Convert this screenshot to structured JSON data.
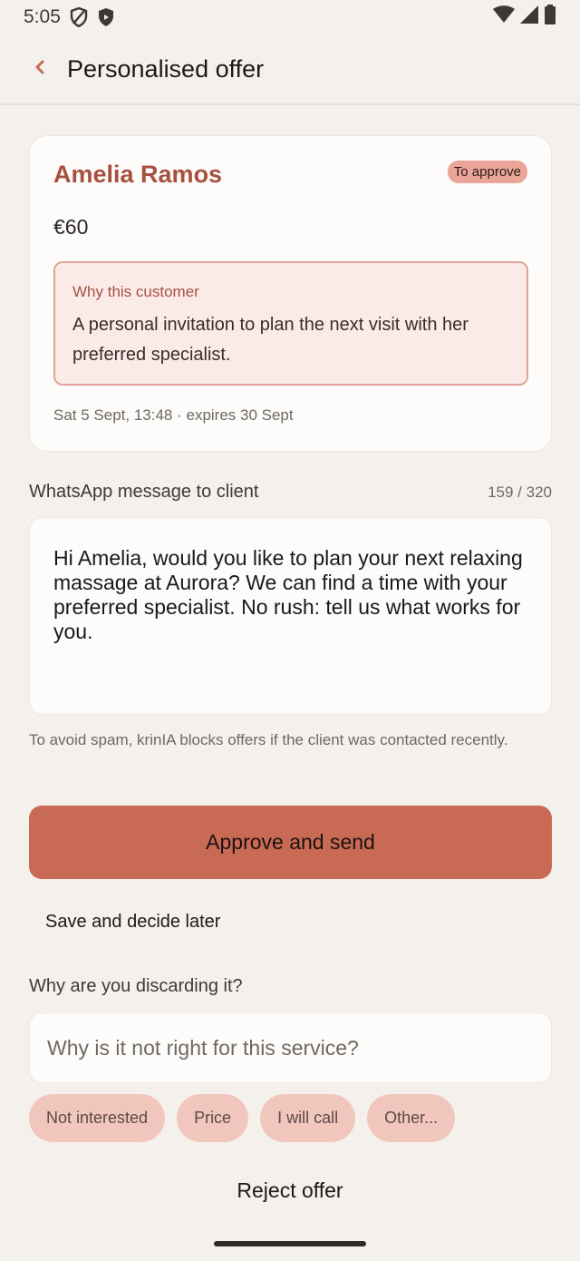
{
  "status_bar": {
    "time": "5:05"
  },
  "app_bar": {
    "title": "Personalised offer"
  },
  "offer": {
    "client_name": "Amelia Ramos",
    "status_badge": "To approve",
    "price": "€60",
    "reason_label": "Why this customer",
    "reason_text": "A personal invitation to plan the next visit with her preferred specialist.",
    "meta": "Sat 5 Sept, 13:48 · expires 30 Sept"
  },
  "message": {
    "label": "WhatsApp message to client",
    "char_count": "159 / 320",
    "text": "Hi Amelia, would you like to plan your next relaxing massage at Aurora? We can find a time with your preferred specialist. No rush: tell us what works for you.",
    "spam_note": "To avoid spam, krinIA blocks offers if the client was contacted recently."
  },
  "actions": {
    "approve_label": "Approve and send",
    "save_later_label": "Save and decide later"
  },
  "discard": {
    "label": "Why are you discarding it?",
    "placeholder": "Why is it not right for this service?",
    "chips": [
      "Not interested",
      "Price",
      "I will call",
      "Other..."
    ],
    "reject_label": "Reject offer"
  },
  "colors": {
    "accent": "#c96a55",
    "name": "#a8503f",
    "background": "#f4f1ed",
    "chip": "#f1c6bd"
  }
}
